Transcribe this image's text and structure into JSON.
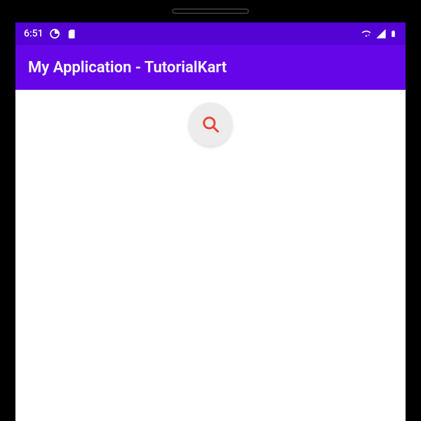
{
  "status_bar": {
    "time": "6:51",
    "icons": {
      "data_saver": "data-saver-icon",
      "sd_card": "sd-card-icon",
      "wifi_disabled": "wifi-disabled-icon",
      "signal": "signal-icon",
      "battery": "battery-icon"
    }
  },
  "app_bar": {
    "title": "My Application - TutorialKart"
  },
  "fab": {
    "icon": "search-icon",
    "icon_color": "#EA4335",
    "bg_color": "#ececec"
  },
  "colors": {
    "status_bar_bg": "#5303d3",
    "app_bar_bg": "#6506e8",
    "content_bg": "#ffffff"
  }
}
